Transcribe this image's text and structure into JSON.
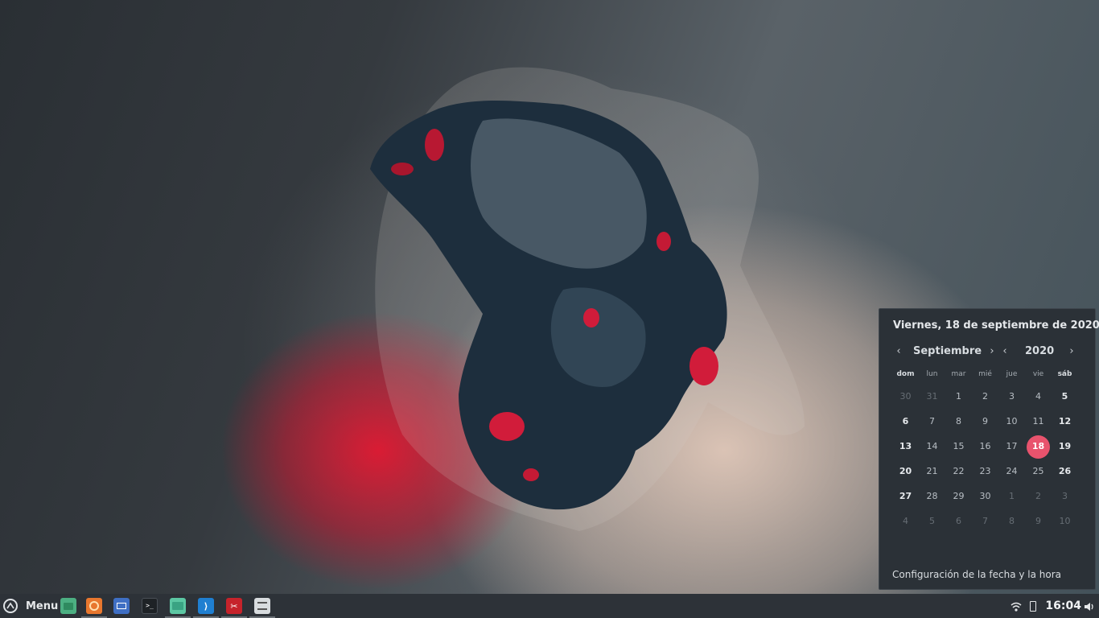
{
  "taskbar": {
    "menu_label": "Menu",
    "launchers": [
      {
        "name": "files-green",
        "color": "#4caf82"
      },
      {
        "name": "firefox",
        "color": "#e8772e"
      },
      {
        "name": "mail",
        "color": "#3f6fc4"
      },
      {
        "name": "terminal",
        "color": "#1e2226"
      },
      {
        "name": "folder",
        "color": "#5cc7a3"
      },
      {
        "name": "vscode",
        "color": "#1f7fd1"
      },
      {
        "name": "screenshot",
        "color": "#c6232b"
      },
      {
        "name": "system-settings",
        "color": "#d8dcdf"
      }
    ],
    "clock": "16:04"
  },
  "calendar": {
    "header": "Viernes, 18 de septiembre de 2020",
    "month": "Septiembre",
    "year": "2020",
    "weekdays": [
      "dom",
      "lun",
      "mar",
      "mié",
      "jue",
      "vie",
      "sáb"
    ],
    "weeks": [
      [
        "30",
        "31",
        "1",
        "2",
        "3",
        "4",
        "5"
      ],
      [
        "6",
        "7",
        "8",
        "9",
        "10",
        "11",
        "12"
      ],
      [
        "13",
        "14",
        "15",
        "16",
        "17",
        "18",
        "19"
      ],
      [
        "20",
        "21",
        "22",
        "23",
        "24",
        "25",
        "26"
      ],
      [
        "27",
        "28",
        "29",
        "30",
        "1",
        "2",
        "3"
      ],
      [
        "4",
        "5",
        "6",
        "7",
        "8",
        "9",
        "10"
      ]
    ],
    "today": "18",
    "accent": "#e8536d",
    "footer_link": "Configuración de la fecha y la hora"
  }
}
